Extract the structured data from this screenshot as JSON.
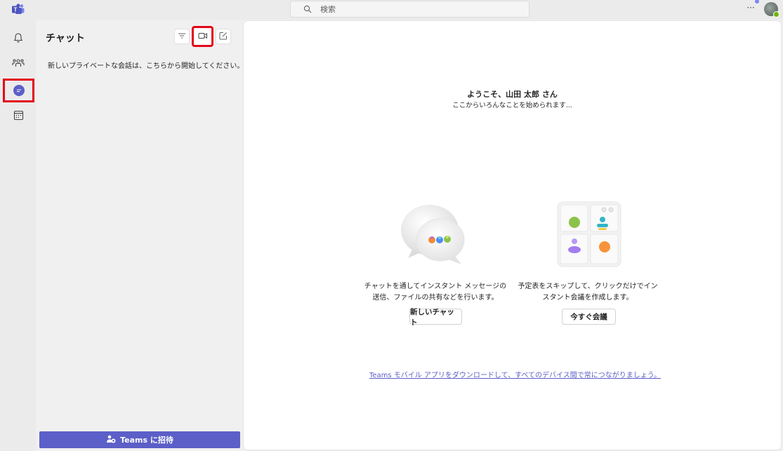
{
  "app": {
    "search_placeholder": "検索",
    "more_label": "···"
  },
  "rail": {
    "items": [
      {
        "name": "activity",
        "icon": "bell-icon"
      },
      {
        "name": "teams",
        "icon": "teams-people-icon"
      },
      {
        "name": "chat",
        "icon": "chat-icon"
      },
      {
        "name": "calendar",
        "icon": "calendar-icon"
      }
    ]
  },
  "chat_panel": {
    "title": "チャット",
    "hint": "新しいプライベートな会話は、こちらから開始してください。",
    "invite_label": "Teams に招待"
  },
  "main": {
    "welcome_title": "ようこそ、山田 太郎 さん",
    "welcome_sub": "ここからいろんなことを始められます...",
    "cards": [
      {
        "text_line1": "チャットを通してインスタント メッセージの",
        "text_line2": "送信、ファイルの共有などを行います。",
        "button": "新しいチャット"
      },
      {
        "text_line1": "予定表をスキップして、クリックだけでイン",
        "text_line2": "スタント会議を作成します。",
        "button": "今すぐ会議"
      }
    ],
    "download_link": "Teams モバイル アプリをダウンロードして、すべてのデバイス間で常につながりましょう。"
  },
  "colors": {
    "accent": "#5b5fc7",
    "highlight": "#e3081a",
    "presence": "#6bb700"
  }
}
